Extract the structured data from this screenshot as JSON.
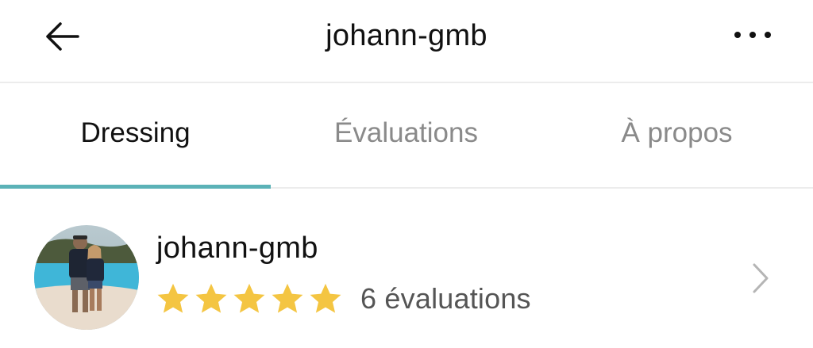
{
  "header": {
    "title": "johann-gmb",
    "back_icon": "arrow-left-icon",
    "more_icon": "more-horizontal-icon"
  },
  "tabs": [
    {
      "label": "Dressing",
      "active": true
    },
    {
      "label": "Évaluations",
      "active": false
    },
    {
      "label": "À propos",
      "active": false
    }
  ],
  "profile": {
    "username": "johann-gmb",
    "rating": 5,
    "max_rating": 5,
    "review_count_label": "6 évaluations",
    "avatar_icon": "avatar-photo",
    "chevron_icon": "chevron-right-icon"
  },
  "colors": {
    "accent": "#5bb2b7",
    "star": "#f4c542",
    "text": "#111111",
    "muted": "#8a8a8a",
    "divider": "#ececec"
  }
}
